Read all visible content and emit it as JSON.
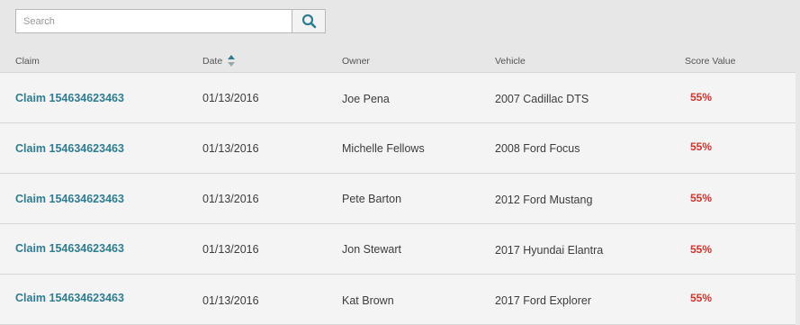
{
  "search": {
    "placeholder": "Search"
  },
  "columns": {
    "claim": "Claim",
    "date": "Date",
    "owner": "Owner",
    "vehicle": "Vehicle",
    "score": "Score Value"
  },
  "icons": {
    "search": "search-icon",
    "sort": "sort-ascending-icon"
  },
  "colors": {
    "link": "#2f7d93",
    "score": "#d6322c",
    "sort_up": "#2f7d93",
    "sort_down": "#9aa8ad"
  },
  "rows": [
    {
      "claim": "Claim 154634623463",
      "date": "01/13/2016",
      "owner": "Joe Pena",
      "vehicle": "2007 Cadillac DTS",
      "score": "55%"
    },
    {
      "claim": "Claim 154634623463",
      "date": "01/13/2016",
      "owner": "Michelle Fellows",
      "vehicle": "2008 Ford Focus",
      "score": "55%"
    },
    {
      "claim": "Claim 154634623463",
      "date": "01/13/2016",
      "owner": "Pete Barton",
      "vehicle": "2012 Ford Mustang",
      "score": "55%"
    },
    {
      "claim": "Claim 154634623463",
      "date": "01/13/2016",
      "owner": "Jon Stewart",
      "vehicle": "2017 Hyundai Elantra",
      "score": "55%"
    },
    {
      "claim": "Claim 154634623463",
      "date": "01/13/2016",
      "owner": "Kat Brown",
      "vehicle": "2017 Ford Explorer",
      "score": "55%"
    }
  ]
}
